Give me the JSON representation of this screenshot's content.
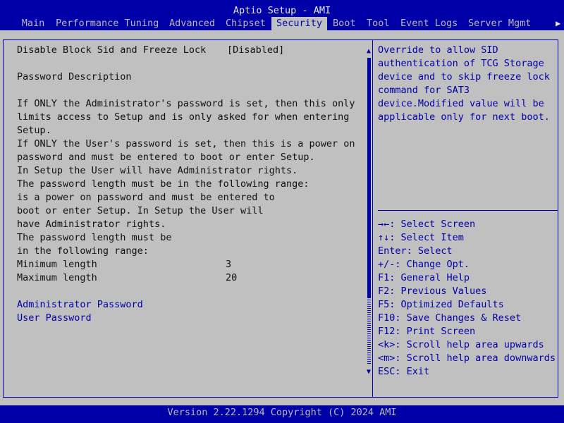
{
  "window": {
    "title": "Aptio Setup - AMI"
  },
  "tabs": [
    {
      "label": "Main"
    },
    {
      "label": "Performance Tuning"
    },
    {
      "label": "Advanced"
    },
    {
      "label": "Chipset"
    },
    {
      "label": "Security",
      "active": true
    },
    {
      "label": "Boot"
    },
    {
      "label": "Tool"
    },
    {
      "label": "Event Logs"
    },
    {
      "label": "Server Mgmt"
    }
  ],
  "tab_more_glyph": "▶",
  "content": {
    "option": {
      "label": "Disable Block Sid and Freeze Lock",
      "value": "[Disabled]"
    },
    "section_heading": "Password Description",
    "description_lines": [
      "If ONLY the Administrator's password is set, then this only",
      "limits access to Setup and is only asked for when entering",
      "Setup.",
      "If ONLY the User's password is set, then this is a power on",
      "password and must be entered to boot or enter Setup.",
      "In Setup the User will have Administrator rights.",
      "The password length must be in the following range:",
      "is a power on password and must be entered to",
      "boot or enter Setup. In Setup the User will",
      "have Administrator rights.",
      "The password length must be",
      "in the following range:"
    ],
    "min_length": {
      "label": "Minimum length",
      "value": "3"
    },
    "max_length": {
      "label": "Maximum length",
      "value": "20"
    },
    "admin_password_label": "Administrator Password",
    "user_password_label": "User Password"
  },
  "help": {
    "lines": [
      "Override to allow SID",
      "authentication of TCG Storage",
      "device and to skip freeze lock",
      "command for SAT3",
      "device.Modified value will be",
      "applicable only for next boot."
    ]
  },
  "keys": [
    "→←: Select Screen",
    "↑↓: Select Item",
    "Enter: Select",
    "+/-: Change Opt.",
    "F1: General Help",
    "F2: Previous Values",
    "F5: Optimized Defaults",
    "F10: Save Changes & Reset",
    "F12: Print Screen",
    "<k>: Scroll help area upwards",
    "<m>: Scroll help area downwards",
    "ESC: Exit"
  ],
  "scrollbar": {
    "up_glyph": "▲",
    "down_glyph": "▼"
  },
  "footer": {
    "text": "Version 2.22.1294 Copyright (C) 2024 AMI"
  },
  "colors": {
    "frame_blue": "#0000a8",
    "panel_gray": "#c0c0c0",
    "text_dark": "#101010"
  }
}
